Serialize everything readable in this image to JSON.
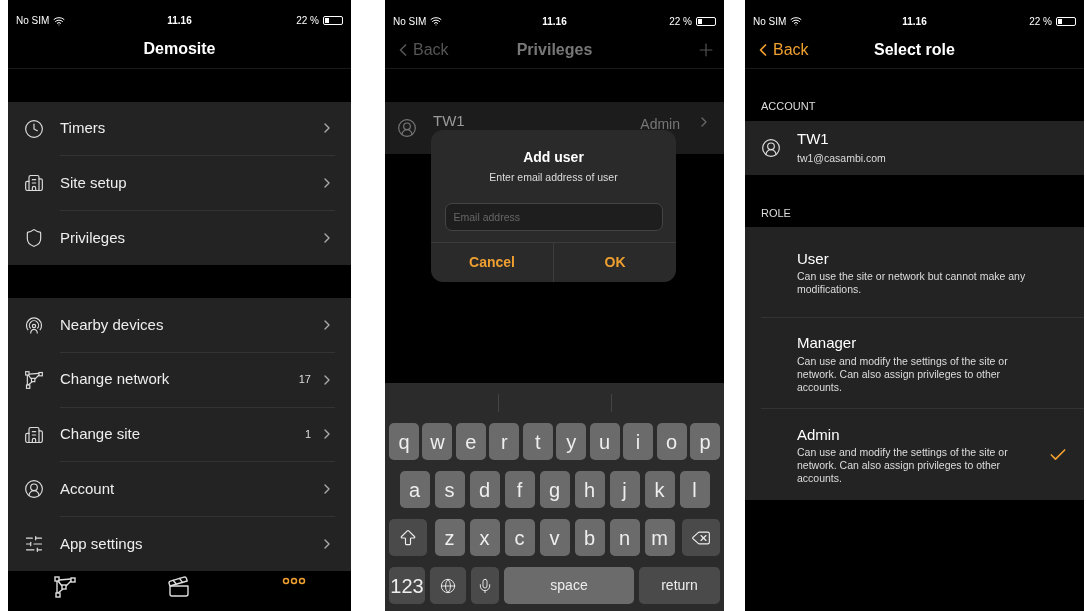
{
  "menu_screen": {
    "status_bar": {
      "carrier": "No SIM",
      "time": "11.16",
      "battery": "22 %"
    },
    "title": "Demosite",
    "groups": [
      [
        {
          "kind": "clock",
          "label": "Timers"
        },
        {
          "kind": "building",
          "label": "Site setup"
        },
        {
          "kind": "shield",
          "label": "Privileges"
        }
      ],
      [
        {
          "kind": "nearby",
          "label": "Nearby devices"
        },
        {
          "kind": "network",
          "label": "Change network",
          "count": "17"
        },
        {
          "kind": "building",
          "label": "Change site",
          "count": "1"
        },
        {
          "kind": "account",
          "label": "Account"
        },
        {
          "kind": "sliders",
          "label": "App settings"
        }
      ]
    ],
    "tab_bar": [
      {
        "kind": "network",
        "selected": false
      },
      {
        "kind": "scenes",
        "selected": false
      },
      {
        "kind": "more",
        "selected": true
      }
    ]
  },
  "privileges_screen": {
    "status_bar": {
      "carrier": "No SIM",
      "time": "11.16",
      "battery": "22 %"
    },
    "back": "Back",
    "title": "Privileges",
    "user": {
      "name": "TW1",
      "role": "Admin"
    },
    "dialog": {
      "title": "Add user",
      "message": "Enter email address of user",
      "placeholder": "Email address",
      "buttons": [
        "Cancel",
        "OK"
      ]
    },
    "keyboard": {
      "rows": [
        [
          "q",
          "w",
          "e",
          "r",
          "t",
          "y",
          "u",
          "i",
          "o",
          "p"
        ],
        [
          "a",
          "s",
          "d",
          "f",
          "g",
          "h",
          "j",
          "k",
          "l"
        ],
        [
          "z",
          "x",
          "c",
          "v",
          "b",
          "n",
          "m"
        ]
      ],
      "numbers": "123",
      "space": "space",
      "return": "return"
    }
  },
  "role_screen": {
    "status_bar": {
      "carrier": "No SIM",
      "time": "11.16",
      "battery": "22 %"
    },
    "back": "Back",
    "title": "Select role",
    "account_header": "ACCOUNT",
    "account": {
      "name": "TW1",
      "email": "tw1@casambi.com"
    },
    "role_header": "ROLE",
    "roles": [
      {
        "name": "User",
        "description": "Can use the site or network but cannot make any modifications.",
        "selected": false
      },
      {
        "name": "Manager",
        "description": "Can use and modify the settings of the site or network. Can also assign privileges to other accounts.",
        "selected": false
      },
      {
        "name": "Admin",
        "description": "Can use and modify the settings of the site or network. Can also assign privileges to other accounts.",
        "selected": true
      }
    ]
  }
}
